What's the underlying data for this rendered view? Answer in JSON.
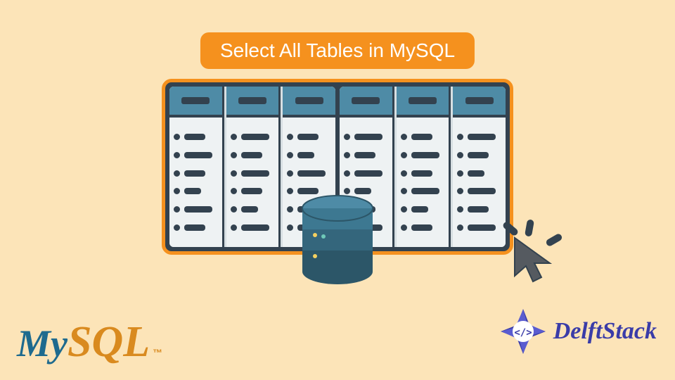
{
  "title": "Select All Tables in MySQL",
  "logos": {
    "mysql_my": "My",
    "mysql_sql": "SQL",
    "mysql_tm": "™",
    "delftstack": "DelftStack"
  },
  "colors": {
    "background": "#fce4b8",
    "accent": "#f5911e",
    "dark": "#33424f",
    "server_head": "#4e8ba6",
    "mysql_blue": "#1e6a8e",
    "mysql_orange": "#d98a1f",
    "delft_blue": "#3a3ca8"
  },
  "icons": {
    "database": "database-icon",
    "cursor": "cursor-icon",
    "server_rack": "server-rack-icon"
  }
}
